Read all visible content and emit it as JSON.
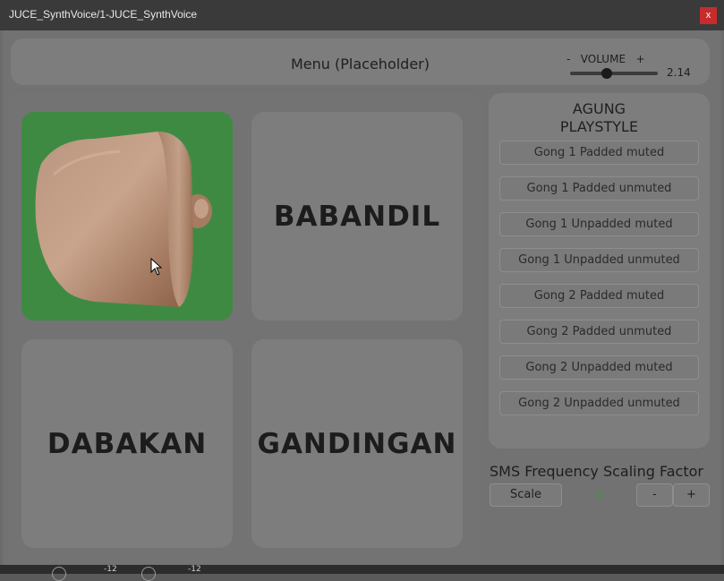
{
  "window": {
    "title": "JUCE_SynthVoice/1-JUCE_SynthVoice",
    "close_label": "x"
  },
  "menu": {
    "title": "Menu (Placeholder)"
  },
  "volume": {
    "label": "-   VOLUME   +",
    "value_text": "2.14",
    "level": 0.42
  },
  "instruments": [
    {
      "name": "",
      "icon": "agung-gong-image"
    },
    {
      "name": "BABANDIL"
    },
    {
      "name": "DABAKAN"
    },
    {
      "name": "GANDINGAN"
    }
  ],
  "playstyle": {
    "title_line1": "AGUNG",
    "title_line2": "PLAYSTYLE",
    "options": [
      "Gong 1 Padded muted",
      "Gong 1 Padded unmuted",
      "Gong 1 Unpadded muted",
      "Gong 1 Unpadded unmuted",
      "Gong 2 Padded muted",
      "Gong 2 Padded unmuted",
      "Gong 2 Unpadded muted",
      "Gong 2 Unpadded unmuted"
    ]
  },
  "sms": {
    "label": "SMS Frequency Scaling Factor",
    "scale_button": "Scale",
    "value": "0",
    "minus": "-",
    "plus": "+"
  },
  "bottom": {
    "db1": "-12",
    "db2": "-12"
  },
  "colors": {
    "accent_green": "#3f8a43",
    "value_green": "#4a8f4e",
    "close_red": "#c62c2c"
  }
}
